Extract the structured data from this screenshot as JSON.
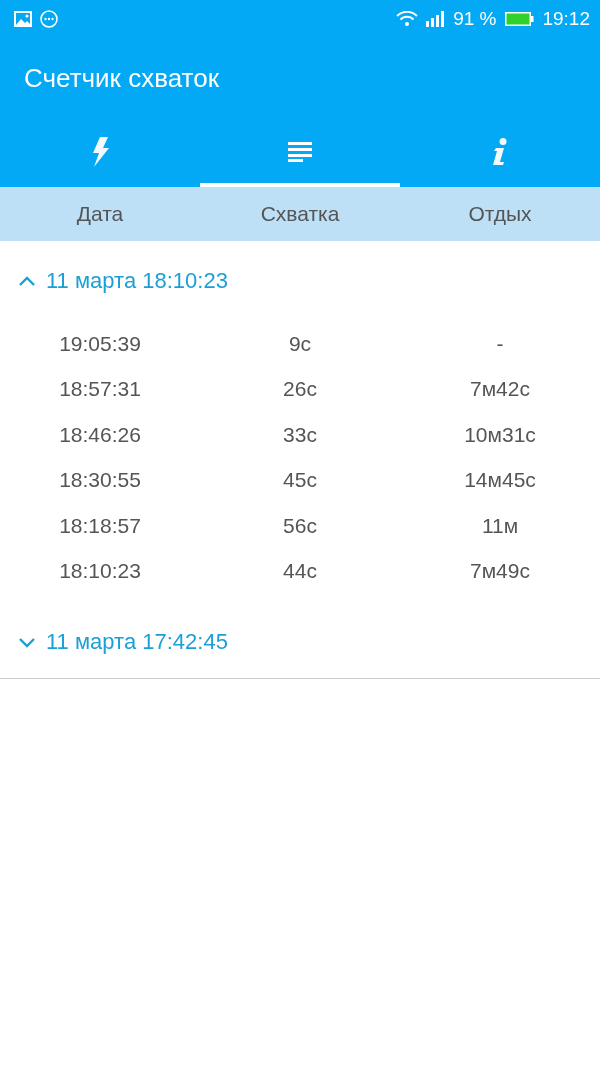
{
  "status_bar": {
    "battery": "91 %",
    "time": "19:12"
  },
  "app_bar": {
    "title": "Счетчик схваток"
  },
  "tabs": [
    {
      "kind": "bolt",
      "selected": false
    },
    {
      "kind": "list",
      "selected": true
    },
    {
      "kind": "info",
      "selected": false
    }
  ],
  "table": {
    "columns": [
      "Дата",
      "Схватка",
      "Отдых"
    ],
    "groups": [
      {
        "title": "11 марта 18:10:23",
        "expanded": true,
        "rows": [
          [
            "19:05:39",
            "9с",
            "-"
          ],
          [
            "18:57:31",
            "26с",
            "7м42с"
          ],
          [
            "18:46:26",
            "33с",
            "10м31с"
          ],
          [
            "18:30:55",
            "45с",
            "14м45с"
          ],
          [
            "18:18:57",
            "56с",
            "11м"
          ],
          [
            "18:10:23",
            "44с",
            "7м49с"
          ]
        ]
      },
      {
        "title": "11 марта 17:42:45",
        "expanded": false
      }
    ]
  }
}
